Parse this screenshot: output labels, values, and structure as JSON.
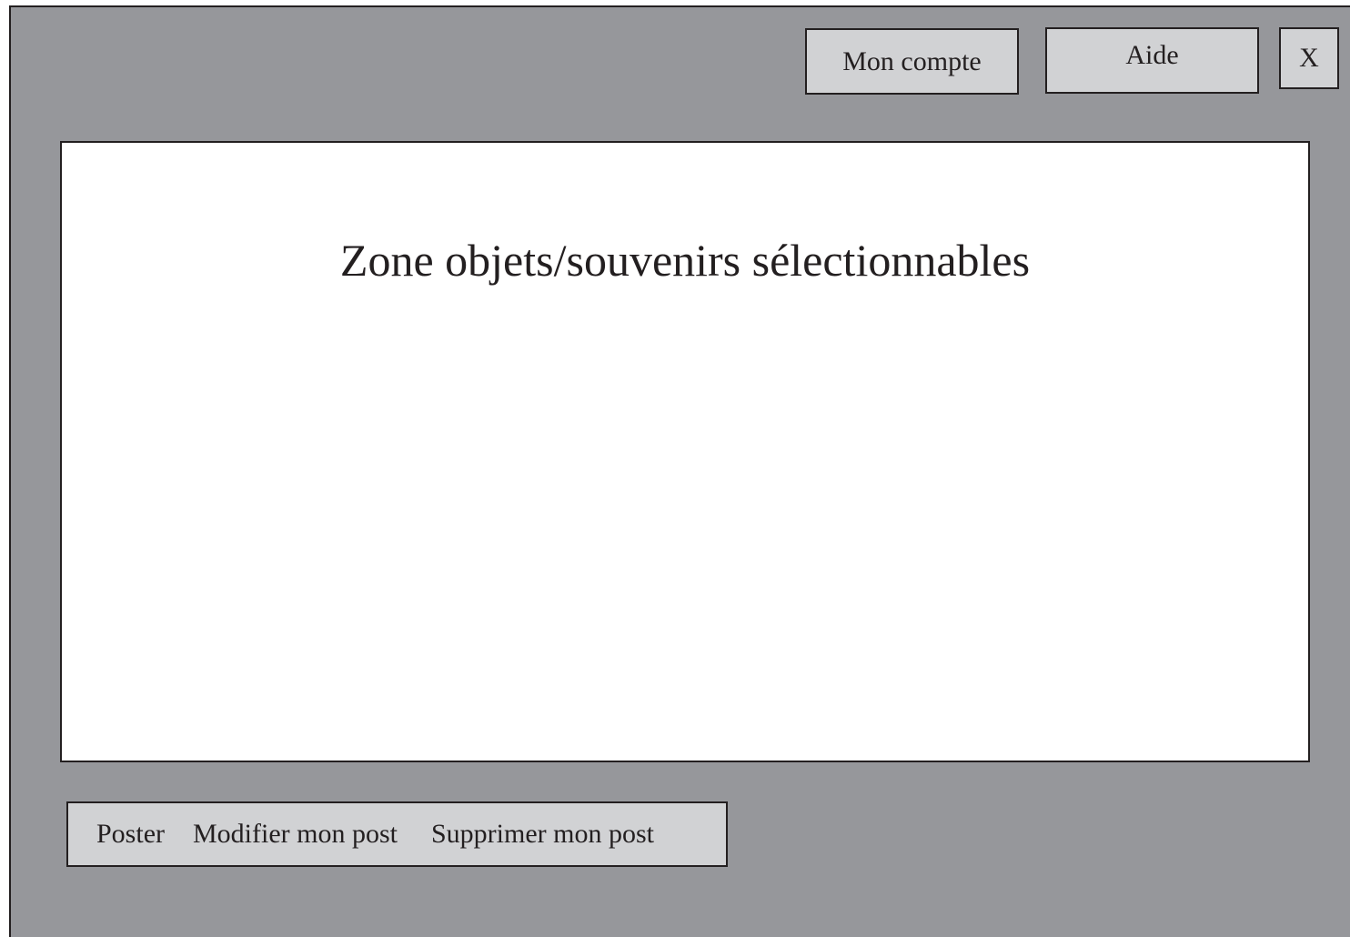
{
  "header": {
    "account_label": "Mon compte",
    "help_label": "Aide",
    "close_label": "X"
  },
  "main": {
    "zone_title": "Zone objets/souvenirs sélectionnables"
  },
  "actions": {
    "post_label": "Poster",
    "edit_label": "Modifier mon post",
    "delete_label": "Supprimer mon post"
  },
  "colors": {
    "window_background": "#96979b",
    "button_background": "#d1d2d4",
    "zone_background": "#ffffff",
    "border": "#231f20"
  }
}
